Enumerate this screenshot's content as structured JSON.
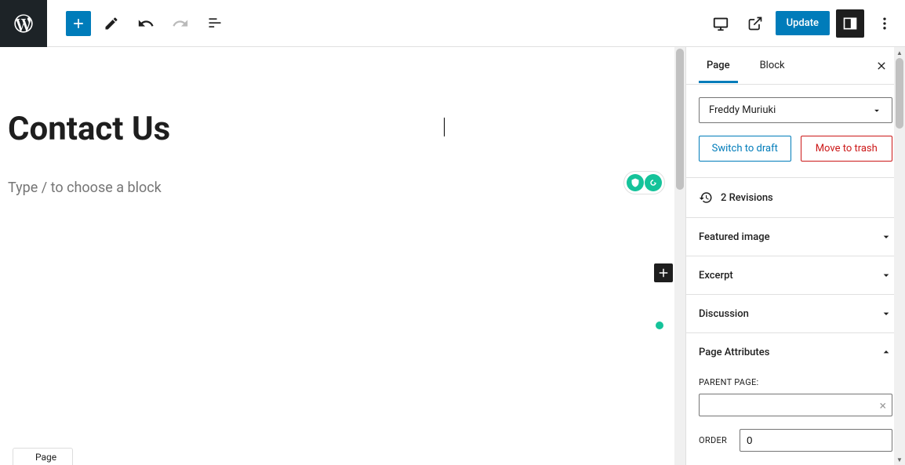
{
  "toolbar": {
    "update_label": "Update"
  },
  "editor": {
    "title": "Contact Us",
    "placeholder": "Type / to choose a block",
    "bottom_tab": "Page"
  },
  "sidebar": {
    "tabs": {
      "page": "Page",
      "block": "Block"
    },
    "author": "Freddy Muriuki",
    "switch_draft": "Switch to draft",
    "move_trash": "Move to trash",
    "revisions": "2 Revisions",
    "panels": {
      "featured_image": "Featured image",
      "excerpt": "Excerpt",
      "discussion": "Discussion",
      "page_attributes": "Page Attributes"
    },
    "parent_page_label": "PARENT PAGE:",
    "order_label": "ORDER",
    "order_value": "0"
  }
}
